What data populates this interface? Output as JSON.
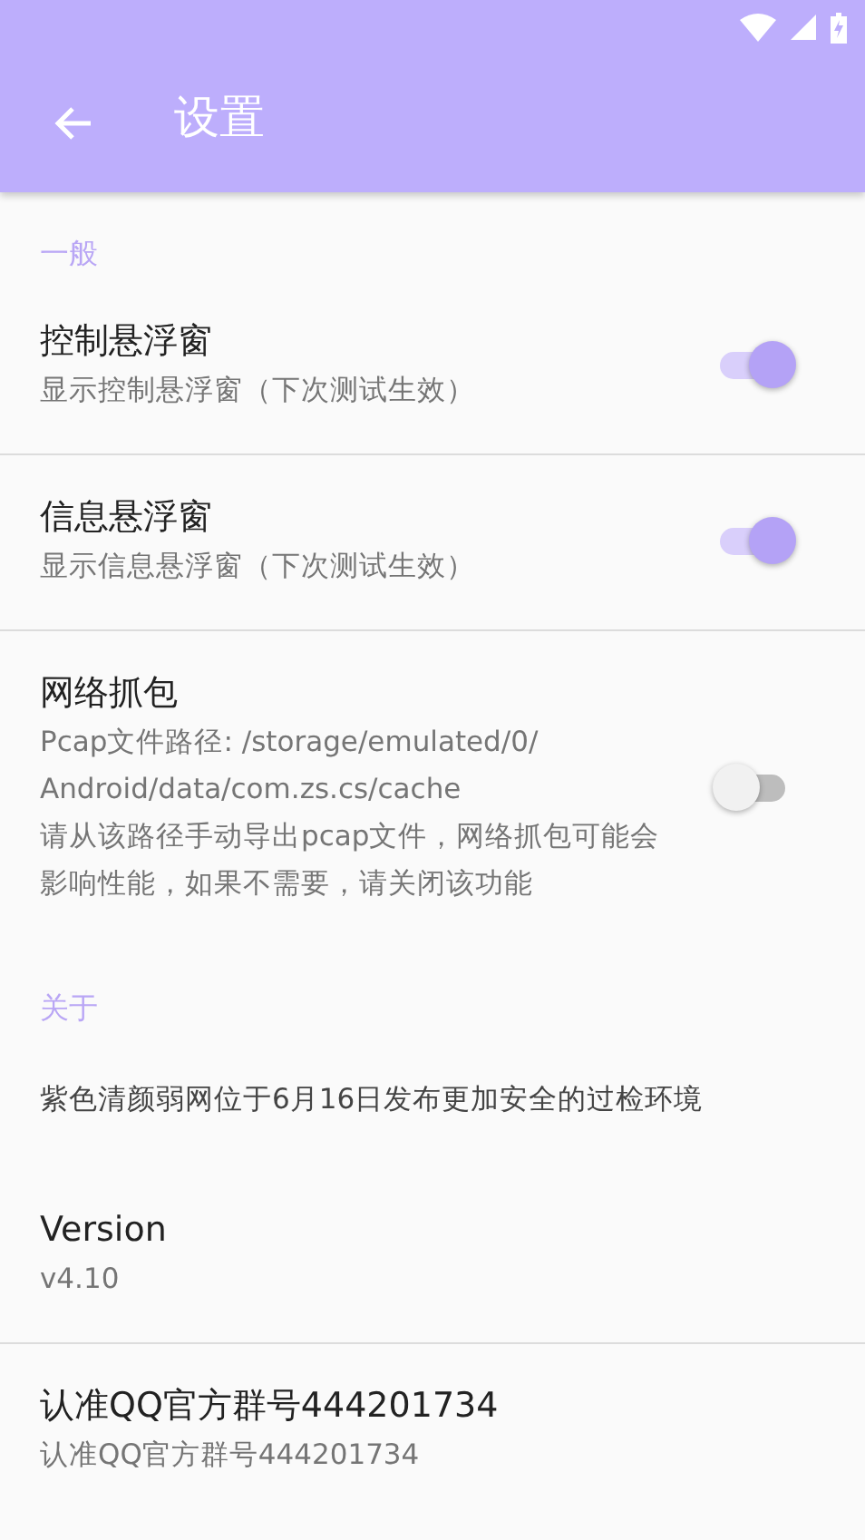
{
  "app_bar": {
    "title": "设置"
  },
  "sections": [
    {
      "header": "一般",
      "items": [
        {
          "kind": "switch",
          "title": "控制悬浮窗",
          "summary": "显示控制悬浮窗（下次测试生效）",
          "on": true
        },
        {
          "kind": "switch",
          "title": "信息悬浮窗",
          "summary": "显示信息悬浮窗（下次测试生效）",
          "on": true
        },
        {
          "kind": "switch",
          "title": "网络抓包",
          "summary": "Pcap文件路径: /storage/emulated/0/\nAndroid/data/com.zs.cs/cache\n请从该路径手动导出pcap文件，网络抓包可能会影响性能，如果不需要，请关闭该功能",
          "on": false
        }
      ]
    },
    {
      "header": "关于",
      "items": [
        {
          "kind": "text",
          "summary": "紫色清颜弱网位于6月16日发布更加安全的过检环境"
        },
        {
          "kind": "info",
          "title": "Version",
          "summary": "v4.10"
        },
        {
          "kind": "info",
          "title": "认准QQ官方群号444201734",
          "summary": "认准QQ官方群号444201734"
        }
      ]
    }
  ]
}
